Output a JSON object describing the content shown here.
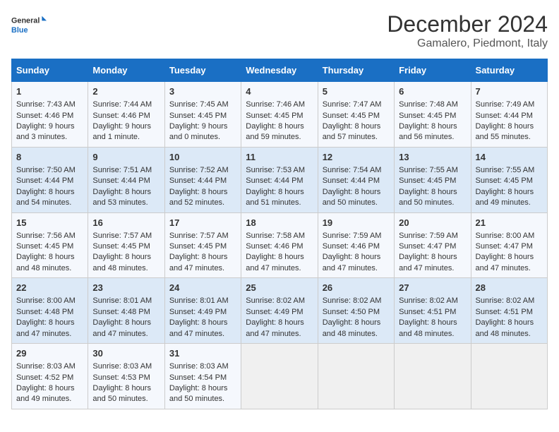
{
  "header": {
    "logo_line1": "General",
    "logo_line2": "Blue",
    "month": "December 2024",
    "location": "Gamalero, Piedmont, Italy"
  },
  "days_of_week": [
    "Sunday",
    "Monday",
    "Tuesday",
    "Wednesday",
    "Thursday",
    "Friday",
    "Saturday"
  ],
  "weeks": [
    [
      {
        "day": "1",
        "lines": [
          "Sunrise: 7:43 AM",
          "Sunset: 4:46 PM",
          "Daylight: 9 hours",
          "and 3 minutes."
        ]
      },
      {
        "day": "2",
        "lines": [
          "Sunrise: 7:44 AM",
          "Sunset: 4:46 PM",
          "Daylight: 9 hours",
          "and 1 minute."
        ]
      },
      {
        "day": "3",
        "lines": [
          "Sunrise: 7:45 AM",
          "Sunset: 4:45 PM",
          "Daylight: 9 hours",
          "and 0 minutes."
        ]
      },
      {
        "day": "4",
        "lines": [
          "Sunrise: 7:46 AM",
          "Sunset: 4:45 PM",
          "Daylight: 8 hours",
          "and 59 minutes."
        ]
      },
      {
        "day": "5",
        "lines": [
          "Sunrise: 7:47 AM",
          "Sunset: 4:45 PM",
          "Daylight: 8 hours",
          "and 57 minutes."
        ]
      },
      {
        "day": "6",
        "lines": [
          "Sunrise: 7:48 AM",
          "Sunset: 4:45 PM",
          "Daylight: 8 hours",
          "and 56 minutes."
        ]
      },
      {
        "day": "7",
        "lines": [
          "Sunrise: 7:49 AM",
          "Sunset: 4:44 PM",
          "Daylight: 8 hours",
          "and 55 minutes."
        ]
      }
    ],
    [
      {
        "day": "8",
        "lines": [
          "Sunrise: 7:50 AM",
          "Sunset: 4:44 PM",
          "Daylight: 8 hours",
          "and 54 minutes."
        ]
      },
      {
        "day": "9",
        "lines": [
          "Sunrise: 7:51 AM",
          "Sunset: 4:44 PM",
          "Daylight: 8 hours",
          "and 53 minutes."
        ]
      },
      {
        "day": "10",
        "lines": [
          "Sunrise: 7:52 AM",
          "Sunset: 4:44 PM",
          "Daylight: 8 hours",
          "and 52 minutes."
        ]
      },
      {
        "day": "11",
        "lines": [
          "Sunrise: 7:53 AM",
          "Sunset: 4:44 PM",
          "Daylight: 8 hours",
          "and 51 minutes."
        ]
      },
      {
        "day": "12",
        "lines": [
          "Sunrise: 7:54 AM",
          "Sunset: 4:44 PM",
          "Daylight: 8 hours",
          "and 50 minutes."
        ]
      },
      {
        "day": "13",
        "lines": [
          "Sunrise: 7:55 AM",
          "Sunset: 4:45 PM",
          "Daylight: 8 hours",
          "and 50 minutes."
        ]
      },
      {
        "day": "14",
        "lines": [
          "Sunrise: 7:55 AM",
          "Sunset: 4:45 PM",
          "Daylight: 8 hours",
          "and 49 minutes."
        ]
      }
    ],
    [
      {
        "day": "15",
        "lines": [
          "Sunrise: 7:56 AM",
          "Sunset: 4:45 PM",
          "Daylight: 8 hours",
          "and 48 minutes."
        ]
      },
      {
        "day": "16",
        "lines": [
          "Sunrise: 7:57 AM",
          "Sunset: 4:45 PM",
          "Daylight: 8 hours",
          "and 48 minutes."
        ]
      },
      {
        "day": "17",
        "lines": [
          "Sunrise: 7:57 AM",
          "Sunset: 4:45 PM",
          "Daylight: 8 hours",
          "and 47 minutes."
        ]
      },
      {
        "day": "18",
        "lines": [
          "Sunrise: 7:58 AM",
          "Sunset: 4:46 PM",
          "Daylight: 8 hours",
          "and 47 minutes."
        ]
      },
      {
        "day": "19",
        "lines": [
          "Sunrise: 7:59 AM",
          "Sunset: 4:46 PM",
          "Daylight: 8 hours",
          "and 47 minutes."
        ]
      },
      {
        "day": "20",
        "lines": [
          "Sunrise: 7:59 AM",
          "Sunset: 4:47 PM",
          "Daylight: 8 hours",
          "and 47 minutes."
        ]
      },
      {
        "day": "21",
        "lines": [
          "Sunrise: 8:00 AM",
          "Sunset: 4:47 PM",
          "Daylight: 8 hours",
          "and 47 minutes."
        ]
      }
    ],
    [
      {
        "day": "22",
        "lines": [
          "Sunrise: 8:00 AM",
          "Sunset: 4:48 PM",
          "Daylight: 8 hours",
          "and 47 minutes."
        ]
      },
      {
        "day": "23",
        "lines": [
          "Sunrise: 8:01 AM",
          "Sunset: 4:48 PM",
          "Daylight: 8 hours",
          "and 47 minutes."
        ]
      },
      {
        "day": "24",
        "lines": [
          "Sunrise: 8:01 AM",
          "Sunset: 4:49 PM",
          "Daylight: 8 hours",
          "and 47 minutes."
        ]
      },
      {
        "day": "25",
        "lines": [
          "Sunrise: 8:02 AM",
          "Sunset: 4:49 PM",
          "Daylight: 8 hours",
          "and 47 minutes."
        ]
      },
      {
        "day": "26",
        "lines": [
          "Sunrise: 8:02 AM",
          "Sunset: 4:50 PM",
          "Daylight: 8 hours",
          "and 48 minutes."
        ]
      },
      {
        "day": "27",
        "lines": [
          "Sunrise: 8:02 AM",
          "Sunset: 4:51 PM",
          "Daylight: 8 hours",
          "and 48 minutes."
        ]
      },
      {
        "day": "28",
        "lines": [
          "Sunrise: 8:02 AM",
          "Sunset: 4:51 PM",
          "Daylight: 8 hours",
          "and 48 minutes."
        ]
      }
    ],
    [
      {
        "day": "29",
        "lines": [
          "Sunrise: 8:03 AM",
          "Sunset: 4:52 PM",
          "Daylight: 8 hours",
          "and 49 minutes."
        ]
      },
      {
        "day": "30",
        "lines": [
          "Sunrise: 8:03 AM",
          "Sunset: 4:53 PM",
          "Daylight: 8 hours",
          "and 50 minutes."
        ]
      },
      {
        "day": "31",
        "lines": [
          "Sunrise: 8:03 AM",
          "Sunset: 4:54 PM",
          "Daylight: 8 hours",
          "and 50 minutes."
        ]
      },
      null,
      null,
      null,
      null
    ]
  ]
}
